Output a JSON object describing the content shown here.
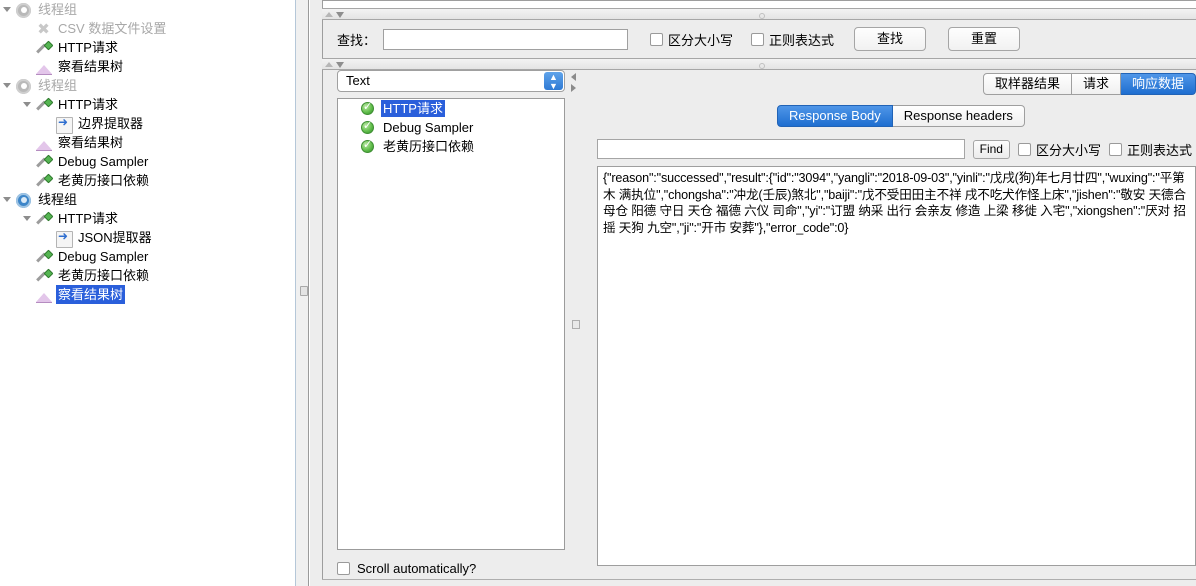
{
  "tree": {
    "nodes": [
      {
        "label": "线程组",
        "icon": "gear-icon",
        "state": "disabled",
        "indent": 0,
        "toggle": "open"
      },
      {
        "label": "CSV 数据文件设置",
        "icon": "csv-config-icon",
        "state": "disabled",
        "indent": 1,
        "toggle": "none"
      },
      {
        "label": "HTTP请求",
        "icon": "pipette-icon",
        "state": "normal",
        "indent": 1,
        "toggle": "none"
      },
      {
        "label": "察看结果树",
        "icon": "view-results-tree-icon",
        "state": "normal",
        "indent": 1,
        "toggle": "none"
      },
      {
        "label": "线程组",
        "icon": "gear-icon",
        "state": "disabled",
        "indent": 0,
        "toggle": "open"
      },
      {
        "label": "HTTP请求",
        "icon": "pipette-icon",
        "state": "normal",
        "indent": 1,
        "toggle": "open"
      },
      {
        "label": "边界提取器",
        "icon": "extractor-icon",
        "state": "normal",
        "indent": 2,
        "toggle": "none"
      },
      {
        "label": "察看结果树",
        "icon": "view-results-tree-icon",
        "state": "normal",
        "indent": 1,
        "toggle": "none"
      },
      {
        "label": "Debug Sampler",
        "icon": "pipette-icon",
        "state": "normal",
        "indent": 1,
        "toggle": "none"
      },
      {
        "label": "老黄历接口依赖",
        "icon": "pipette-icon",
        "state": "normal",
        "indent": 1,
        "toggle": "none"
      },
      {
        "label": "线程组",
        "icon": "gear-running-icon",
        "state": "normal",
        "indent": 0,
        "toggle": "open"
      },
      {
        "label": "HTTP请求",
        "icon": "pipette-icon",
        "state": "normal",
        "indent": 1,
        "toggle": "open"
      },
      {
        "label": "JSON提取器",
        "icon": "extractor-icon",
        "state": "normal",
        "indent": 2,
        "toggle": "none"
      },
      {
        "label": "Debug Sampler",
        "icon": "pipette-icon",
        "state": "normal",
        "indent": 1,
        "toggle": "none"
      },
      {
        "label": "老黄历接口依赖",
        "icon": "pipette-icon",
        "state": "normal",
        "indent": 1,
        "toggle": "none"
      },
      {
        "label": "察看结果树",
        "icon": "view-results-tree-icon",
        "state": "selected",
        "indent": 1,
        "toggle": "none"
      }
    ]
  },
  "search_toolbar": {
    "find_label": "查找：",
    "find_value": "",
    "case_sensitive_label": "区分大小写",
    "regex_label": "正则表达式",
    "search_button": "查找",
    "reset_button": "重置"
  },
  "sampler": {
    "render_selected": "Text",
    "results": [
      {
        "label": "HTTP请求",
        "selected": true
      },
      {
        "label": "Debug Sampler",
        "selected": false
      },
      {
        "label": "老黄历接口依赖",
        "selected": false
      }
    ],
    "scroll_automatically_label": "Scroll automatically?"
  },
  "detail": {
    "tabs": [
      {
        "label": "取样器结果",
        "active": false
      },
      {
        "label": "请求",
        "active": false
      },
      {
        "label": "响应数据",
        "active": true
      }
    ],
    "subtabs": [
      {
        "label": "Response Body",
        "active": true
      },
      {
        "label": "Response headers",
        "active": false
      }
    ],
    "find": {
      "value": "",
      "button_label": "Find",
      "case_sensitive_label": "区分大小写",
      "regex_label": "正则表达式"
    },
    "response_body": "{\"reason\":\"successed\",\"result\":{\"id\":\"3094\",\"yangli\":\"2018-09-03\",\"yinli\":\"戊戌(狗)年七月廿四\",\"wuxing\":\"平第木 满执位\",\"chongsha\":\"冲龙(壬辰)煞北\",\"baiji\":\"戊不受田田主不祥 戌不吃犬作怪上床\",\"jishen\":\"敬安 天德合 母仓 阳德 守日 天仓 福德 六仪 司命\",\"yi\":\"订盟 纳采 出行 会亲友 修造 上梁 移徙 入宅\",\"xiongshen\":\"厌对 招摇 天狗 九空\",\"ji\":\"开市 安葬\"},\"error_code\":0}"
  },
  "colors": {
    "selection_blue": "#2a5fdb",
    "tab_active_blue": "#1e6ed0",
    "panel_gray": "#ededed"
  }
}
